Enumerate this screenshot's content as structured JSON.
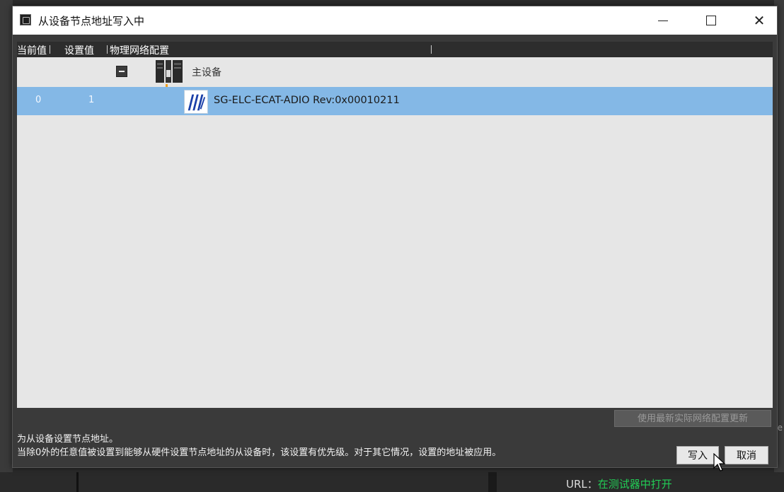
{
  "window": {
    "title": "从设备节点地址写入中"
  },
  "columns": {
    "current": "当前值",
    "set": "设置值",
    "topology": "物理网络配置"
  },
  "tree": {
    "master_label": "主设备",
    "slave": {
      "current_value": "0",
      "set_value": "1",
      "label": "SG-ELC-ECAT-ADIO Rev:0x00010211"
    }
  },
  "refresh_button": "使用最新实际网络配置更新",
  "description": {
    "line1": "为从设备设置节点地址。",
    "line2": "当除0外的任意值被设置到能够从硬件设置节点地址的从设备时，该设置有优先级。对于其它情况，设置的地址被应用。"
  },
  "buttons": {
    "write": "写入",
    "cancel": "取消"
  },
  "background": {
    "bottom_label": "URL：",
    "bottom_value": "在测试器中打开",
    "right_fragment": "e"
  },
  "colors": {
    "selected_row": "#84b8e6",
    "connector": "#f0a020",
    "dialog_body": "#3a3a3a",
    "tree_bg": "#e6e6e6"
  }
}
